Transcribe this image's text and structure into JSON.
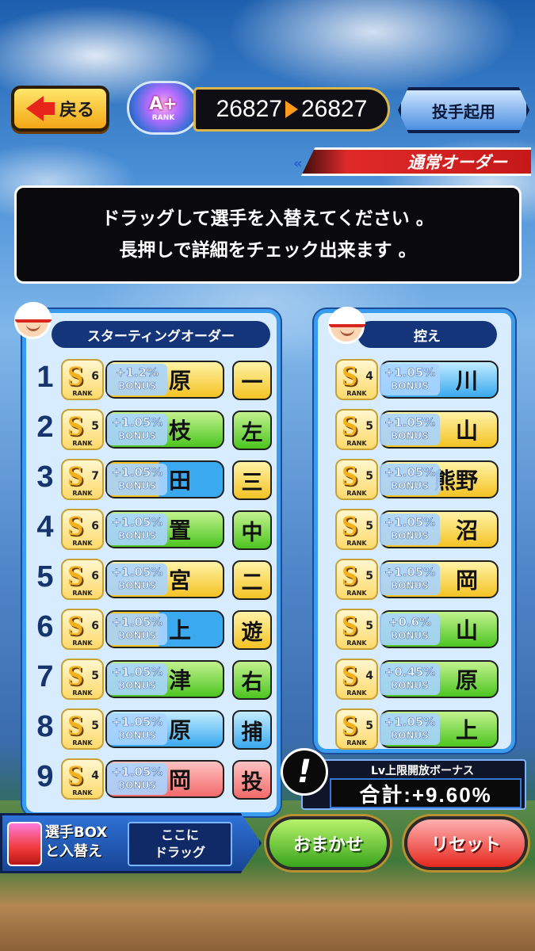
{
  "header": {
    "back_label": "戻る",
    "rank_label": "A+",
    "rank_sub": "RANK",
    "score_from": "26827",
    "score_to": "26827",
    "pitcher_button": "投手起用",
    "order_type": "通常オーダー"
  },
  "info": {
    "line1": "ドラッグして選手を入替えてください 。",
    "line2": "長押しで詳細をチェック出来ます 。"
  },
  "starting": {
    "title": "スターティングオーダー",
    "players": [
      {
        "num": "1",
        "rank": "S",
        "sub": "6",
        "rank_label": "RANK",
        "bonus": "+1.2%",
        "bonus_label": "BONUS",
        "name": "原",
        "pos": "一",
        "bar_color": "yellow",
        "pos_color": "yellow"
      },
      {
        "num": "2",
        "rank": "S",
        "sub": "5",
        "rank_label": "RANK",
        "bonus": "+1.05%",
        "bonus_label": "BONUS",
        "name": "枝",
        "pos": "左",
        "bar_color": "green",
        "pos_color": "green"
      },
      {
        "num": "3",
        "rank": "S",
        "sub": "7",
        "rank_label": "RANK",
        "bonus": "+1.05%",
        "bonus_label": "BONUS",
        "name": "田",
        "pos": "三",
        "bar_color": "split-yb",
        "pos_color": "yellow"
      },
      {
        "num": "4",
        "rank": "S",
        "sub": "6",
        "rank_label": "RANK",
        "bonus": "+1.05%",
        "bonus_label": "BONUS",
        "name": "置",
        "pos": "中",
        "bar_color": "green",
        "pos_color": "green"
      },
      {
        "num": "5",
        "rank": "S",
        "sub": "6",
        "rank_label": "RANK",
        "bonus": "+1.05%",
        "bonus_label": "BONUS",
        "name": "宮",
        "pos": "二",
        "bar_color": "yellow",
        "pos_color": "yellow"
      },
      {
        "num": "6",
        "rank": "S",
        "sub": "6",
        "rank_label": "RANK",
        "bonus": "+1.05%",
        "bonus_label": "BONUS",
        "name": "上",
        "pos": "遊",
        "bar_color": "split-yb",
        "pos_color": "yellow"
      },
      {
        "num": "7",
        "rank": "S",
        "sub": "5",
        "rank_label": "RANK",
        "bonus": "+1.05%",
        "bonus_label": "BONUS",
        "name": "津",
        "pos": "右",
        "bar_color": "green",
        "pos_color": "green"
      },
      {
        "num": "8",
        "rank": "S",
        "sub": "5",
        "rank_label": "RANK",
        "bonus": "+1.05%",
        "bonus_label": "BONUS",
        "name": "原",
        "pos": "捕",
        "bar_color": "blue",
        "pos_color": "blue"
      },
      {
        "num": "9",
        "rank": "S",
        "sub": "4",
        "rank_label": "RANK",
        "bonus": "+1.05%",
        "bonus_label": "BONUS",
        "name": "岡",
        "pos": "投",
        "bar_color": "red",
        "pos_color": "red"
      }
    ]
  },
  "bench": {
    "title": "控え",
    "players": [
      {
        "rank": "S",
        "sub": "4",
        "rank_label": "RANK",
        "bonus": "+1.05%",
        "bonus_label": "BONUS",
        "name": "川",
        "bar_color": "blue"
      },
      {
        "rank": "S",
        "sub": "5",
        "rank_label": "RANK",
        "bonus": "+1.05%",
        "bonus_label": "BONUS",
        "name": "山",
        "bar_color": "yellow"
      },
      {
        "rank": "S",
        "sub": "5",
        "rank_label": "RANK",
        "bonus": "+1.05%",
        "bonus_label": "BONUS",
        "name": "熊野",
        "bar_color": "yellow"
      },
      {
        "rank": "S",
        "sub": "5",
        "rank_label": "RANK",
        "bonus": "+1.05%",
        "bonus_label": "BONUS",
        "name": "沼",
        "bar_color": "yellow"
      },
      {
        "rank": "S",
        "sub": "5",
        "rank_label": "RANK",
        "bonus": "+1.05%",
        "bonus_label": "BONUS",
        "name": "岡",
        "bar_color": "yellow"
      },
      {
        "rank": "S",
        "sub": "5",
        "rank_label": "RANK",
        "bonus": "+0.6%",
        "bonus_label": "BONUS",
        "name": "山",
        "bar_color": "green"
      },
      {
        "rank": "S",
        "sub": "4",
        "rank_label": "RANK",
        "bonus": "+0.45%",
        "bonus_label": "BONUS",
        "name": "原",
        "bar_color": "green"
      },
      {
        "rank": "S",
        "sub": "5",
        "rank_label": "RANK",
        "bonus": "+1.05%",
        "bonus_label": "BONUS",
        "name": "上",
        "bar_color": "green"
      }
    ]
  },
  "level_bonus": {
    "title": "Lv上限開放ボーナス",
    "total": "合計:+9.60%",
    "warn_icon": "!"
  },
  "footer": {
    "box_label_1": "選手BOX",
    "box_label_2": "と入替え",
    "drag_1": "ここに",
    "drag_2": "ドラッグ",
    "auto_button": "おまかせ",
    "reset_button": "リセット"
  }
}
